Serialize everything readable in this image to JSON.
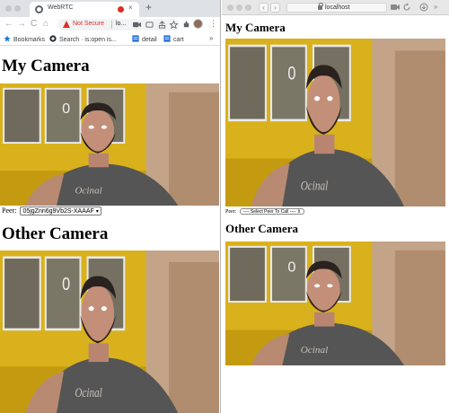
{
  "left_window": {
    "tab": {
      "title": "WebRTC",
      "close_glyph": "×",
      "icon": "globe-icon"
    },
    "new_tab_glyph": "+",
    "toolbar": {
      "back_glyph": "←",
      "forward_glyph": "→",
      "reload_glyph": "C",
      "home_glyph": "⌂",
      "security_label": "Not Secure",
      "url": "lo...",
      "more_glyph": "⋮"
    },
    "bookmarks": [
      {
        "label": "Bookmarks",
        "icon": "star-icon"
      },
      {
        "label": "Search · is:open is...",
        "icon": "github-icon"
      },
      {
        "label": "detail",
        "icon": "page-icon"
      },
      {
        "label": "cart",
        "icon": "page-icon"
      }
    ],
    "bookmarks_more": "»",
    "page": {
      "my_camera_heading": "My Camera",
      "peer_label": "Peer:",
      "peer_selected": "05jgZnn6g9Vb2S-XAAAF",
      "other_camera_heading": "Other Camera"
    }
  },
  "right_window": {
    "toolbar": {
      "back_glyph": "‹",
      "forward_glyph": "›",
      "url": "localhost",
      "more_glyph": "»"
    },
    "page": {
      "my_camera_heading": "My Camera",
      "peer_label": "Peer:",
      "peer_selected": "---- Select Peer To Call ----",
      "other_camera_heading": "Other Camera"
    }
  },
  "colors": {
    "chrome_tabstrip": "#dee1e6",
    "not_secure_red": "#d93025",
    "recording_dot": "#d93025",
    "safari_bar": "#e7e7e7"
  }
}
